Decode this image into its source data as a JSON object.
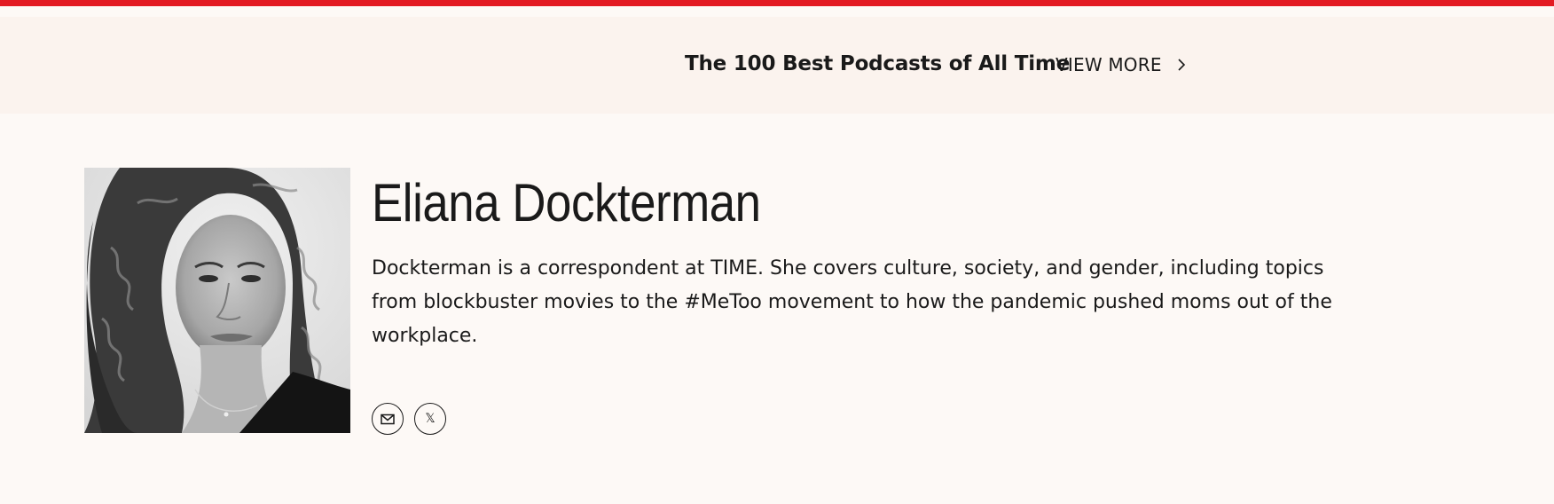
{
  "colors": {
    "accent_red": "#e31b23",
    "promo_bg": "#fbf3ee",
    "page_bg": "#fdf9f6",
    "text": "#1a1a1a"
  },
  "promo": {
    "title": "The 100 Best Podcasts of All Time",
    "view_more_label": "VIEW MORE",
    "chevron_icon": "chevron-right-icon"
  },
  "author": {
    "name": "Eliana Dockterman",
    "bio": "Dockterman is a correspondent at TIME. She covers culture, society, and gender, including topics from blockbuster movies to the #MeToo movement to how the pandemic pushed moms out of the workplace.",
    "photo_icon": "author-portrait"
  },
  "social": {
    "email_icon": "email-icon",
    "x_icon": "x-icon",
    "x_glyph": "𝕏"
  }
}
